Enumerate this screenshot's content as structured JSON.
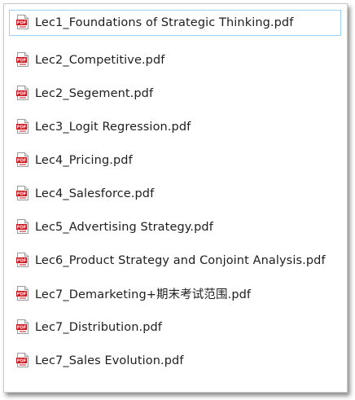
{
  "files": [
    {
      "name": "Lec1_Foundations of Strategic Thinking.pdf",
      "icon": "pdf-icon",
      "selected": true
    },
    {
      "name": "Lec2_Competitive.pdf",
      "icon": "pdf-icon",
      "selected": false
    },
    {
      "name": "Lec2_Segement.pdf",
      "icon": "pdf-icon",
      "selected": false
    },
    {
      "name": "Lec3_Logit Regression.pdf",
      "icon": "pdf-icon",
      "selected": false
    },
    {
      "name": "Lec4_Pricing.pdf",
      "icon": "pdf-icon",
      "selected": false
    },
    {
      "name": "Lec4_Salesforce.pdf",
      "icon": "pdf-icon",
      "selected": false
    },
    {
      "name": "Lec5_Advertising Strategy.pdf",
      "icon": "pdf-icon",
      "selected": false
    },
    {
      "name": "Lec6_Product Strategy and Conjoint Analysis.pdf",
      "icon": "pdf-icon",
      "selected": false
    },
    {
      "name": "Lec7_Demarketing+期末考试范围.pdf",
      "icon": "pdf-icon",
      "selected": false
    },
    {
      "name": "Lec7_Distribution.pdf",
      "icon": "pdf-icon",
      "selected": false
    },
    {
      "name": "Lec7_Sales Evolution.pdf",
      "icon": "pdf-icon",
      "selected": false
    }
  ],
  "icon_text": "PDF",
  "colors": {
    "pdf_red": "#c8161d",
    "selection_border": "#99d1ff",
    "text": "#1e1e1e"
  }
}
